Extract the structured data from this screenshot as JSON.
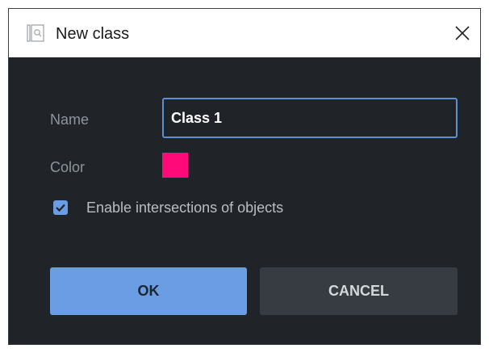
{
  "dialog": {
    "title": "New class",
    "title_icon": "class-search-icon",
    "close_icon": "close-icon"
  },
  "form": {
    "name_label": "Name",
    "name_value": "Class 1",
    "color_label": "Color",
    "color_value": "#ff0a78",
    "enable_intersections_label": "Enable intersections of objects",
    "enable_intersections_checked": true
  },
  "buttons": {
    "ok_label": "OK",
    "cancel_label": "CANCEL"
  },
  "colors": {
    "accent": "#6a9de3",
    "background": "#202429",
    "input_border": "#5b8fd6"
  }
}
